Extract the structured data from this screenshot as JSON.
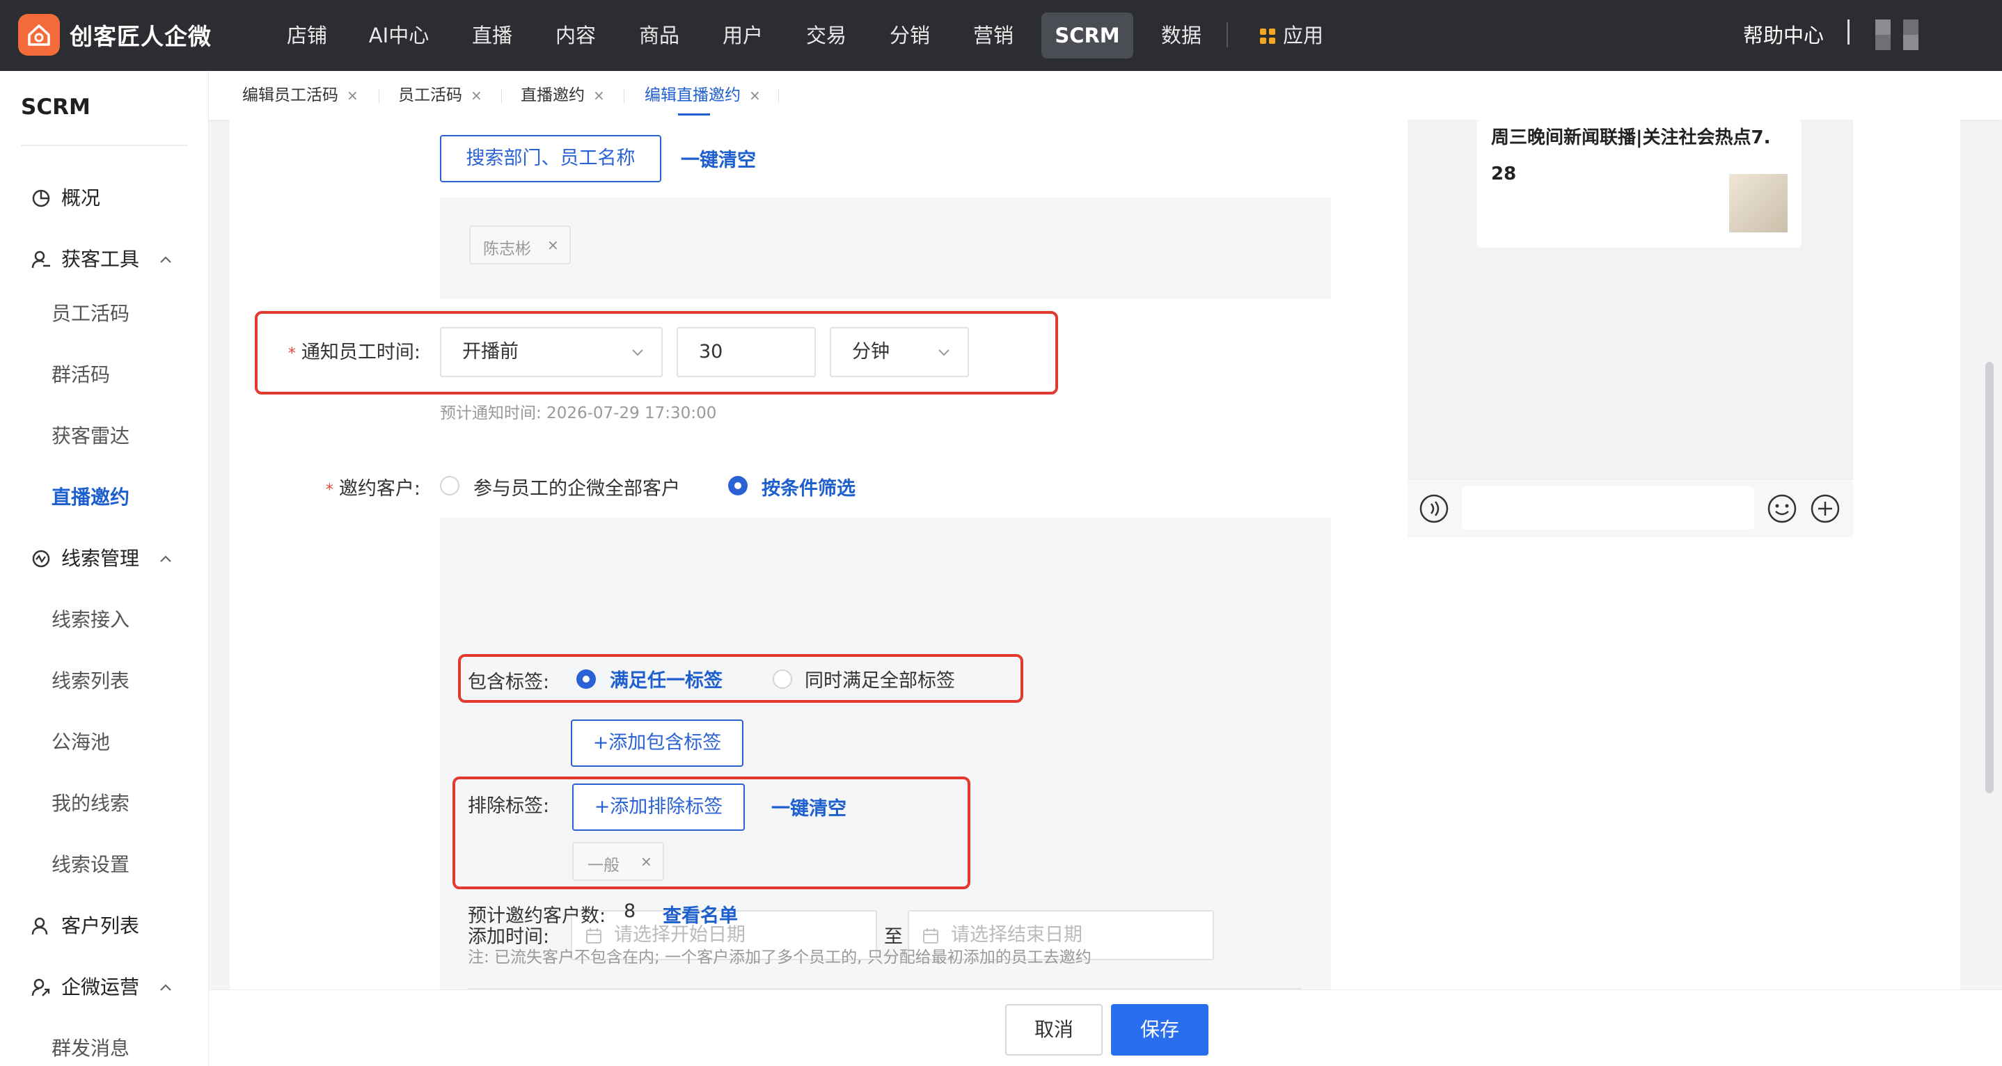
{
  "brand": {
    "name": "创客匠人企微"
  },
  "nav": {
    "items": [
      "店铺",
      "AI中心",
      "直播",
      "内容",
      "商品",
      "用户",
      "交易",
      "分销",
      "营销",
      "SCRM",
      "数据",
      "应用"
    ],
    "active": "SCRM",
    "help": "帮助中心",
    "sep": "|"
  },
  "sidebar": {
    "title": "SCRM",
    "overview": "概况",
    "group_acquire": "获客工具",
    "acquire_items": [
      "员工活码",
      "群活码",
      "获客雷达",
      "直播邀约"
    ],
    "group_leads": "线索管理",
    "lead_items": [
      "线索接入",
      "线索列表",
      "公海池",
      "我的线索",
      "线索设置"
    ],
    "customers": "客户列表",
    "group_ops": "企微运营",
    "ops_items": [
      "群发消息"
    ]
  },
  "tabs": [
    {
      "label": "编辑员工活码",
      "close": "×"
    },
    {
      "label": "员工活码",
      "close": "×"
    },
    {
      "label": "直播邀约",
      "close": "×"
    },
    {
      "label": "编辑直播邀约",
      "close": "×"
    }
  ],
  "form": {
    "search_button": "搜索部门、员工名称",
    "clear_all": "一键清空",
    "selected_employee": "陈志彬",
    "chip_close": "×",
    "notify_label": "通知员工时间:",
    "notify_when": "开播前",
    "notify_value": "30",
    "notify_unit": "分钟",
    "notify_hint": "预计通知时间: 2026-07-29 17:30:00",
    "invite_label": "邀约客户:",
    "invite_opt_all": "参与员工的企微全部客户",
    "invite_opt_filter": "按条件筛选",
    "include_label": "包含标签:",
    "include_any": "满足任一标签",
    "include_all": "同时满足全部标签",
    "add_include": "+添加包含标签",
    "exclude_label": "排除标签:",
    "add_exclude": "+添加排除标签",
    "exclude_clear": "一键清空",
    "exclude_tag": "一般",
    "time_label": "添加时间:",
    "start_placeholder": "请选择开始日期",
    "to": "至",
    "end_placeholder": "请选择结束日期",
    "estimate_label": "预计邀约客户数:",
    "estimate_value": "8",
    "view_list": "查看名单",
    "note": "注: 已流失客户不包含在内; 一个客户添加了多个员工的, 只分配给最初添加的员工去邀约"
  },
  "preview": {
    "card_title_line1": "周三晚间新闻联播|关注社会热点7.",
    "card_title_line2": "28"
  },
  "footer": {
    "cancel": "取消",
    "save": "保存"
  }
}
